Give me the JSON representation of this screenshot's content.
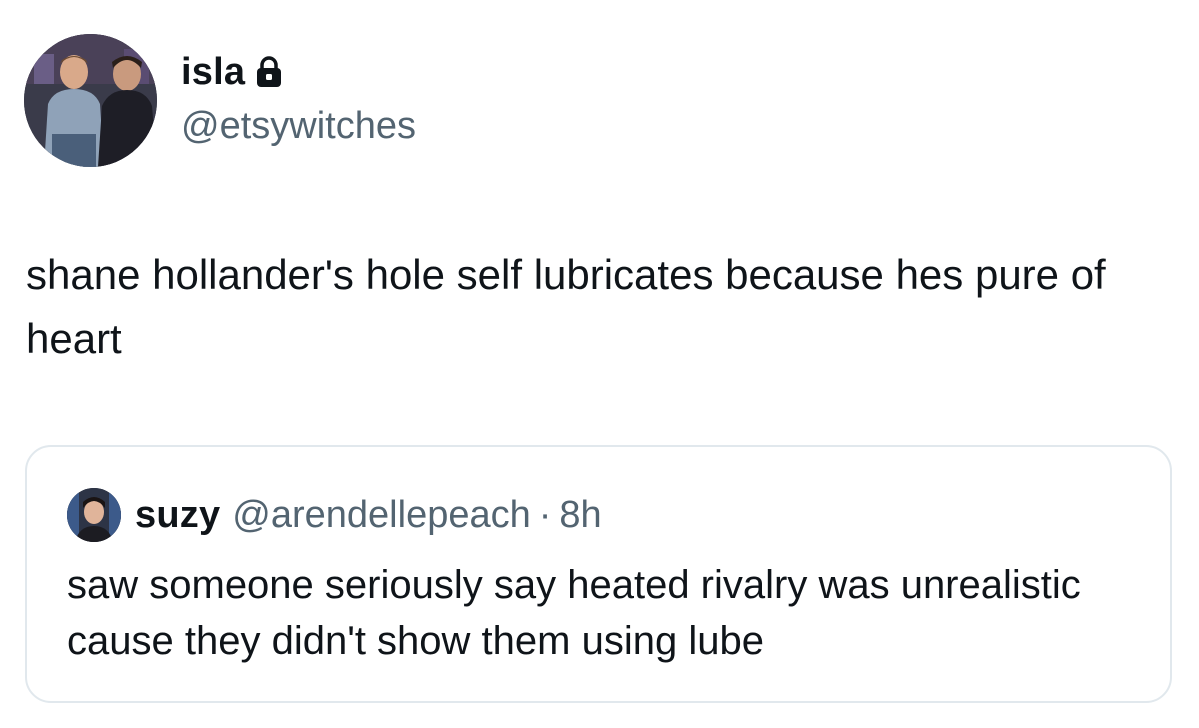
{
  "tweet": {
    "display_name": "isla",
    "handle": "@etsywitches",
    "text": "shane hollander's hole self lubricates because hes pure of heart",
    "lock_icon": "lock-icon",
    "avatar_icon": "profile-photo"
  },
  "quote": {
    "display_name": "suzy",
    "handle": "@arendellepeach",
    "separator": "·",
    "time": "8h",
    "text": "saw someone seriously say heated rivalry was unrealistic cause they didn't show them using lube",
    "avatar_icon": "profile-photo"
  },
  "colors": {
    "text_primary": "#0f1419",
    "text_secondary": "#536471",
    "border": "#e1e8ed",
    "background": "#ffffff"
  }
}
